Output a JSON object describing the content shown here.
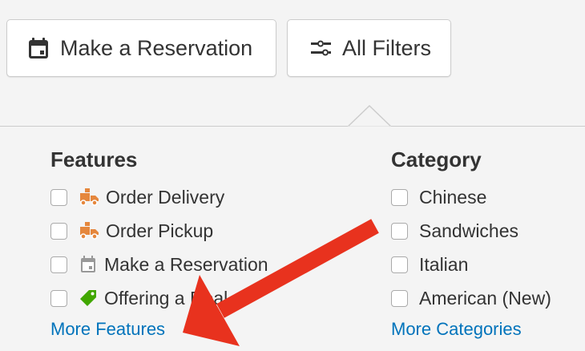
{
  "buttons": {
    "reservation_label": "Make a Reservation",
    "filters_label": "All Filters"
  },
  "features": {
    "title": "Features",
    "options": [
      {
        "label": "Order Delivery",
        "icon": "delivery-truck-icon"
      },
      {
        "label": "Order Pickup",
        "icon": "delivery-truck-icon"
      },
      {
        "label": "Make a Reservation",
        "icon": "calendar-icon"
      },
      {
        "label": "Offering a Deal",
        "icon": "tag-icon"
      }
    ],
    "more_label": "More Features"
  },
  "category": {
    "title": "Category",
    "options": [
      {
        "label": "Chinese"
      },
      {
        "label": "Sandwiches"
      },
      {
        "label": "Italian"
      },
      {
        "label": "American (New)"
      }
    ],
    "more_label": "More Categories"
  },
  "colors": {
    "link": "#0073bb",
    "truck": "#e5873d",
    "tag": "#41a700",
    "annotation_arrow": "#e8321e"
  }
}
